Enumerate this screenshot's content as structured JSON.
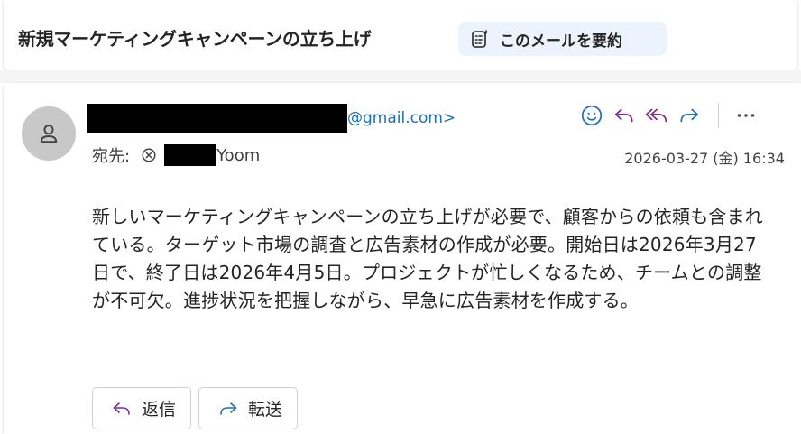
{
  "header": {
    "subject": "新規マーケティングキャンペーンの立ち上げ",
    "summarize_label": "このメールを要約",
    "summarize_icon": "sparkle-summary-icon"
  },
  "message": {
    "avatar_icon": "person-icon",
    "sender_email_suffix": "@gmail.com>",
    "to_label": "宛先:",
    "to_recipient_suffix": "Yoom",
    "date": "2026-03-27 (金) 16:34",
    "body": "新しいマーケティングキャンペーンの立ち上げが必要で、顧客からの依頼も含まれている。ターゲット市場の調査と広告素材の作成が必要。開始日は2026年3月27日で、終了日は2026年4月5日。プロジェクトが忙しくなるため、チームとの調整が不可欠。進捗状況を把握しながら、早急に広告素材を作成する。",
    "actions": [
      "emoji-icon",
      "reply-icon",
      "reply-all-icon",
      "forward-icon",
      "more-icon"
    ],
    "reply_label": "返信",
    "forward_label": "転送"
  },
  "colors": {
    "accent_blue": "#1f6fb5",
    "reply_purple": "#7b2c8f",
    "summary_bg": "#edf3fc"
  }
}
